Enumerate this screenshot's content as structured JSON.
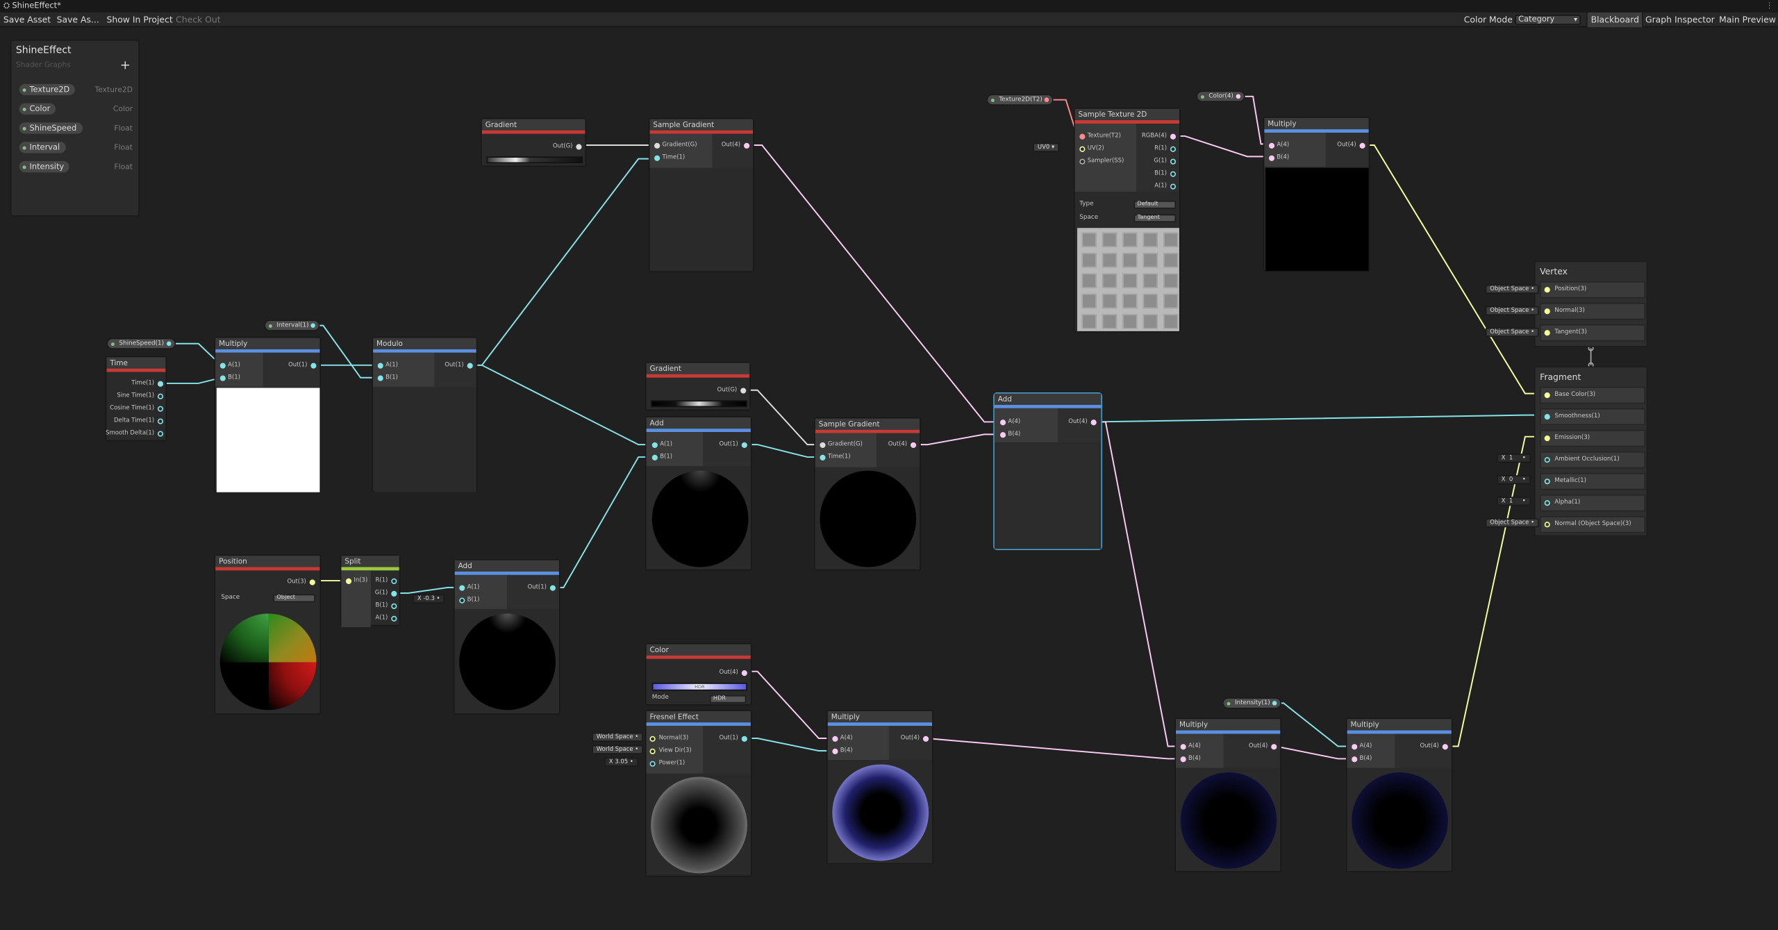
{
  "window": {
    "title": "ShineEffect*"
  },
  "toolbar": {
    "save_asset": "Save Asset",
    "save_as": "Save As...",
    "show_in_project": "Show In Project",
    "check_out": "Check Out",
    "color_mode_label": "Color Mode",
    "color_mode_value": "Category",
    "blackboard": "Blackboard",
    "graph_inspector": "Graph Inspector",
    "main_preview": "Main Preview"
  },
  "blackboard": {
    "title": "ShineEffect",
    "subtitle": "Shader Graphs",
    "add_icon": "plus-icon",
    "properties": [
      {
        "name": "Texture2D",
        "type": "Texture2D"
      },
      {
        "name": "Color",
        "type": "Color"
      },
      {
        "name": "ShineSpeed",
        "type": "Float"
      },
      {
        "name": "Interval",
        "type": "Float"
      },
      {
        "name": "Intensity",
        "type": "Float"
      }
    ]
  },
  "colors": {
    "float_wire": "#84e4e7",
    "vector4_wire": "#fbcbf4",
    "vector3_wire": "#f6ff9a",
    "texture_wire": "#ff8b8b",
    "math_category": "#5b8fe0",
    "input_category": "#c73a35",
    "channel_category": "#9bc93e"
  },
  "nodes": {
    "gradient1": {
      "title": "Gradient",
      "out": "Out(G)"
    },
    "sample_gradient1": {
      "title": "Sample Gradient",
      "in1": "Gradient(G)",
      "in2": "Time(1)",
      "out": "Out(4)"
    },
    "sample_texture": {
      "title": "Sample Texture 2D",
      "in1": "Texture(T2)",
      "in2": "UV(2)",
      "in3": "Sampler(SS)",
      "out1": "RGBA(4)",
      "out2": "R(1)",
      "out3": "G(1)",
      "out4": "B(1)",
      "out5": "A(1)",
      "type_label": "Type",
      "type_value": "Default",
      "space_label": "Space",
      "space_value": "Tangent",
      "uv_chip": "UV0"
    },
    "multiply_top": {
      "title": "Multiply",
      "in1": "A(4)",
      "in2": "B(4)",
      "out": "Out(4)"
    },
    "time": {
      "title": "Time",
      "outs": [
        "Time(1)",
        "Sine Time(1)",
        "Cosine Time(1)",
        "Delta Time(1)",
        "Smooth Delta(1)"
      ]
    },
    "multiply1": {
      "title": "Multiply",
      "in1": "A(1)",
      "in2": "B(1)",
      "out": "Out(1)"
    },
    "modulo": {
      "title": "Modulo",
      "in1": "A(1)",
      "in2": "B(1)",
      "out": "Out(1)"
    },
    "gradient2": {
      "title": "Gradient",
      "out": "Out(G)"
    },
    "add1": {
      "title": "Add",
      "in1": "A(1)",
      "in2": "B(1)",
      "out": "Out(1)"
    },
    "sample_gradient2": {
      "title": "Sample Gradient",
      "in1": "Gradient(G)",
      "in2": "Time(1)",
      "out": "Out(4)"
    },
    "add_sel": {
      "title": "Add",
      "in1": "A(4)",
      "in2": "B(4)",
      "out": "Out(4)"
    },
    "position": {
      "title": "Position",
      "out": "Out(3)",
      "space_label": "Space",
      "space_value": "Object"
    },
    "split": {
      "title": "Split",
      "in": "In(3)",
      "outs": [
        "R(1)",
        "G(1)",
        "B(1)",
        "A(1)"
      ]
    },
    "add2": {
      "title": "Add",
      "in1": "A(1)",
      "in2": "B(1)",
      "out": "Out(1)",
      "b_chip_label": "X",
      "b_chip_value": "-0.3"
    },
    "color": {
      "title": "Color",
      "out": "Out(4)",
      "hdr": "HDR",
      "mode_label": "Mode",
      "mode_value": "HDR"
    },
    "fresnel": {
      "title": "Fresnel Effect",
      "in1": "Normal(3)",
      "in2": "View Dir(3)",
      "in3": "Power(1)",
      "out": "Out(1)",
      "chip1": "World Space",
      "chip2": "World Space",
      "power_label": "X",
      "power_value": "3.05"
    },
    "multiply2": {
      "title": "Multiply",
      "in1": "A(4)",
      "in2": "B(4)",
      "out": "Out(4)"
    },
    "multiply3": {
      "title": "Multiply",
      "in1": "A(4)",
      "in2": "B(4)",
      "out": "Out(4)"
    },
    "multiply4": {
      "title": "Multiply",
      "in1": "A(4)",
      "in2": "B(4)",
      "out": "Out(4)"
    }
  },
  "property_nodes": {
    "texture2d": "Texture2D(T2)",
    "color": "Color(4)",
    "shinespeed": "ShineSpeed(1)",
    "interval": "Interval(1)",
    "intensity": "Intensity(1)"
  },
  "vertex": {
    "title": "Vertex",
    "blocks": [
      "Position(3)",
      "Normal(3)",
      "Tangent(3)"
    ],
    "chips": [
      "Object Space",
      "Object Space",
      "Object Space"
    ]
  },
  "fragment": {
    "title": "Fragment",
    "blocks": [
      "Base Color(3)",
      "Smoothness(1)",
      "Emission(3)",
      "Ambient Occlusion(1)",
      "Metallic(1)",
      "Alpha(1)",
      "Normal (Object Space)(3)"
    ],
    "chip_labels": [
      "X",
      "X",
      "X"
    ],
    "chip_values": [
      "1",
      "0",
      "1"
    ],
    "normal_chip": "Object Space"
  }
}
